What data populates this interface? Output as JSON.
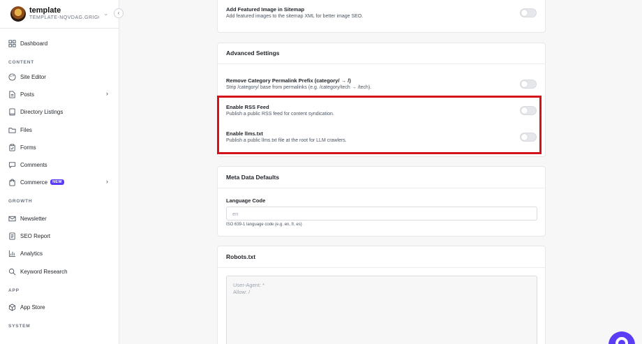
{
  "site": {
    "name": "template",
    "slug": "TEMPLATE-NQVDAG.GRIGOR..."
  },
  "sidebar": {
    "items": [
      {
        "label": "Dashboard",
        "icon": "dashboard-icon"
      },
      {
        "label": "Site Editor",
        "icon": "palette-icon"
      },
      {
        "label": "Posts",
        "icon": "document-icon"
      },
      {
        "label": "Directory Listings",
        "icon": "book-icon"
      },
      {
        "label": "Files",
        "icon": "folder-icon"
      },
      {
        "label": "Forms",
        "icon": "clipboard-icon"
      },
      {
        "label": "Comments",
        "icon": "comment-icon"
      },
      {
        "label": "Commerce",
        "icon": "bag-icon",
        "badge": "NEW"
      },
      {
        "label": "Newsletter",
        "icon": "mail-icon"
      },
      {
        "label": "SEO Report",
        "icon": "report-icon"
      },
      {
        "label": "Analytics",
        "icon": "chart-icon"
      },
      {
        "label": "Keyword Research",
        "icon": "search-icon"
      },
      {
        "label": "App Store",
        "icon": "package-icon"
      }
    ],
    "sections": {
      "content": "CONTENT",
      "growth": "GROWTH",
      "app": "APP",
      "system": "SYSTEM"
    }
  },
  "sitemap_card": {
    "setting_title": "Add Featured Image in Sitemap",
    "setting_desc": "Add featured images to the sitemap XML for better image SEO.",
    "enabled": false
  },
  "advanced_card": {
    "title": "Advanced Settings",
    "settings": [
      {
        "title": "Remove Category Permalink Prefix (category/ → /)",
        "desc": "Strip /category/ base from permalinks (e.g. /category/tech → /tech).",
        "enabled": false
      },
      {
        "title": "Enable RSS Feed",
        "desc": "Publish a public RSS feed for content syndication.",
        "enabled": false
      },
      {
        "title": "Enable llms.txt",
        "desc": "Publish a public llms.txt file at the root for LLM crawlers.",
        "enabled": false
      }
    ]
  },
  "meta_card": {
    "title": "Meta Data Defaults",
    "language_label": "Language Code",
    "language_placeholder": "en",
    "language_help": "ISO 639-1 language code (e.g. en, fr, es)"
  },
  "robots_card": {
    "title": "Robots.txt",
    "placeholder": "User-Agent: *\nAllow: /"
  },
  "colors": {
    "accent": "#5b3df5",
    "highlight": "#d5111b"
  }
}
